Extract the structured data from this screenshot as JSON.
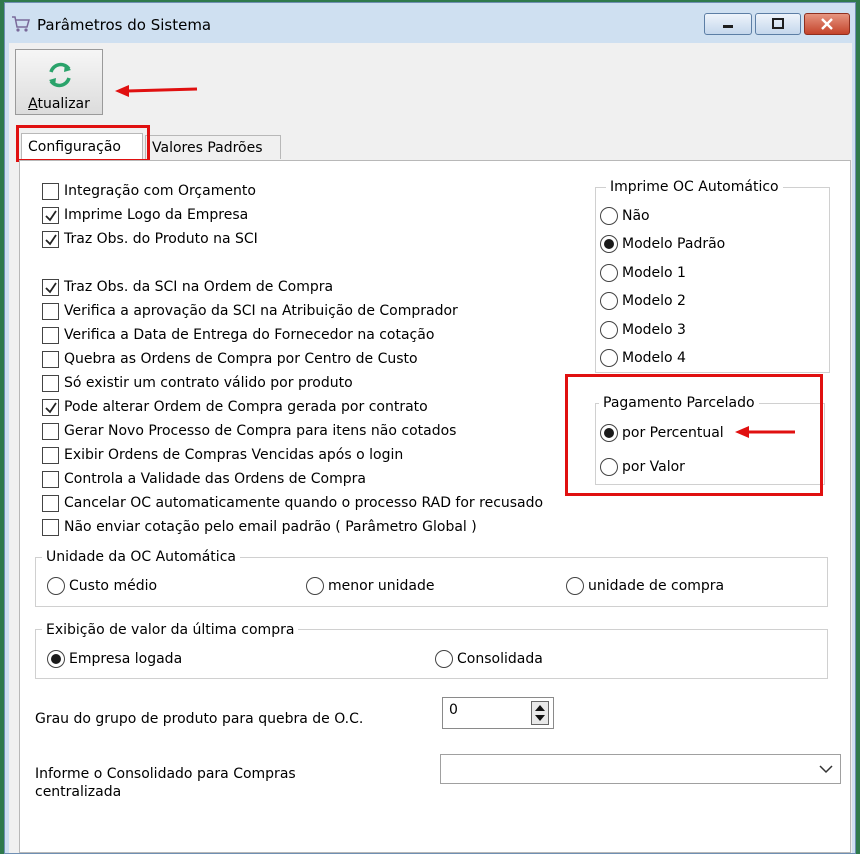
{
  "window": {
    "title": "Parâmetros do Sistema"
  },
  "toolbar": {
    "refresh_label": "Atualizar",
    "refresh_accesskey": "A",
    "refresh_rest": "tualizar"
  },
  "tabs": [
    {
      "label": "Configuração",
      "active": true
    },
    {
      "label": "Valores Padrões",
      "active": false
    }
  ],
  "checkboxes": [
    {
      "label": "Integração com Orçamento",
      "checked": false
    },
    {
      "label": "Imprime Logo da Empresa",
      "checked": true
    },
    {
      "label": "Traz Obs. do Produto na SCI",
      "checked": true
    },
    {
      "label": "Traz Obs. da SCI na Ordem de Compra",
      "checked": true
    },
    {
      "label": "Verifica a aprovação da SCI na Atribuição de Comprador",
      "checked": false
    },
    {
      "label": "Verifica a Data de Entrega do Fornecedor na cotação",
      "checked": false
    },
    {
      "label": "Quebra as Ordens de Compra por Centro de Custo",
      "checked": false
    },
    {
      "label": "Só existir um contrato válido por produto",
      "checked": false
    },
    {
      "label": "Pode alterar Ordem de Compra gerada por contrato",
      "checked": true
    },
    {
      "label": "Gerar Novo Processo de Compra para itens não cotados",
      "checked": false
    },
    {
      "label": "Exibir Ordens de Compras Vencidas após o login",
      "checked": false
    },
    {
      "label": "Controla a Validade das Ordens de Compra",
      "checked": false
    },
    {
      "label": "Cancelar OC automaticamente quando o processo RAD for recusado",
      "checked": false
    },
    {
      "label": "Não enviar cotação pelo email padrão ( Parâmetro Global )",
      "checked": false
    }
  ],
  "imprime_oc": {
    "title": "Imprime OC Automático",
    "options": [
      {
        "label": "Não",
        "selected": false
      },
      {
        "label": "Modelo Padrão",
        "selected": true
      },
      {
        "label": "Modelo 1",
        "selected": false
      },
      {
        "label": "Modelo 2",
        "selected": false
      },
      {
        "label": "Modelo 3",
        "selected": false
      },
      {
        "label": "Modelo 4",
        "selected": false
      }
    ]
  },
  "pagamento": {
    "title": "Pagamento Parcelado",
    "options": [
      {
        "label": "por Percentual",
        "selected": true
      },
      {
        "label": "por Valor",
        "selected": false
      }
    ]
  },
  "unidade_oc": {
    "title": "Unidade da OC Automática",
    "options": [
      {
        "label": "Custo médio",
        "selected": false
      },
      {
        "label": "menor unidade",
        "selected": false
      },
      {
        "label": "unidade de compra",
        "selected": false
      }
    ]
  },
  "exibicao_valor": {
    "title": "Exibição de valor da última compra",
    "options": [
      {
        "label": "Empresa logada",
        "selected": true
      },
      {
        "label": "Consolidada",
        "selected": false
      }
    ]
  },
  "grau_grupo": {
    "label": "Grau do grupo de produto para quebra de O.C.",
    "value": "0"
  },
  "consolidado": {
    "label_line1": "Informe o Consolidado para Compras",
    "label_line2": "centralizada",
    "value": ""
  },
  "colors": {
    "highlight": "#e01010",
    "arrow": "#e01010",
    "refresh_icon": "#2aa36b"
  }
}
